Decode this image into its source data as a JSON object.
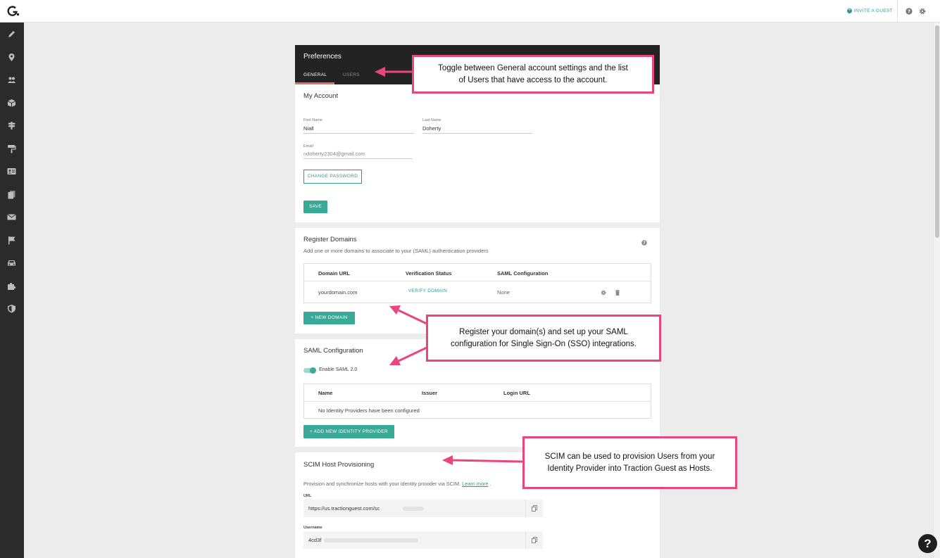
{
  "topbar": {
    "invite_label": "INVITE A GUEST"
  },
  "preferences": {
    "title": "Preferences",
    "tabs": [
      "GENERAL",
      "USERS"
    ],
    "active_tab": "GENERAL"
  },
  "my_account": {
    "title": "My Account",
    "first_name_label": "First Name",
    "first_name": "Niall",
    "last_name_label": "Last Name",
    "last_name": "Doherty",
    "email_label": "Email",
    "email": "ndoherty2304@gmail.com",
    "change_password_label": "CHANGE PASSWORD",
    "save_label": "SAVE"
  },
  "register_domains": {
    "title": "Register Domains",
    "description": "Add one or more domains to associate to your (SAML) authentication providers",
    "columns": [
      "Domain URL",
      "Verification Status",
      "SAML Configuration"
    ],
    "rows": [
      {
        "domain": "yourdomain.com",
        "status": "VERIFY DOMAIN",
        "saml": "None"
      }
    ],
    "new_domain_label": "+ NEW DOMAIN"
  },
  "saml_config": {
    "title": "SAML Configuration",
    "toggle_label": "Enable SAML 2.0",
    "toggle_on": true,
    "columns": [
      "Name",
      "Issuer",
      "Login URL"
    ],
    "empty_text": "No Identity Providers have been configured",
    "add_provider_label": "+ ADD NEW IDENTITY PROVIDER"
  },
  "scim": {
    "title": "SCIM Host Provisioning",
    "description": "Provision and synchronize hosts with your identity provider via SCIM.",
    "learn_more": "Learn more",
    "learn_more_suffix": ".",
    "url_label": "URL",
    "url_value": "https://us.tractionguest.com/sc",
    "username_label": "Username",
    "username_value": "4cd3f"
  },
  "callouts": {
    "tabs_line1": "Toggle between General account settings and the list",
    "tabs_line2": "of Users that have access to the account.",
    "domains_line1": "Register your domain(s) and set up your SAML",
    "domains_line2": "configuration for Single Sign-On (SSO) integrations.",
    "scim_line1": "SCIM can be used to provision Users from your",
    "scim_line2": "Identity Provider into Traction Guest as Hosts."
  },
  "help_button_label": "?",
  "colors": {
    "accent": "#2a9a8a",
    "button_fill": "#3aaa98",
    "callout_border": "#e8467c",
    "header_bg": "#232323",
    "sidebar_bg": "#2b2b2b"
  }
}
